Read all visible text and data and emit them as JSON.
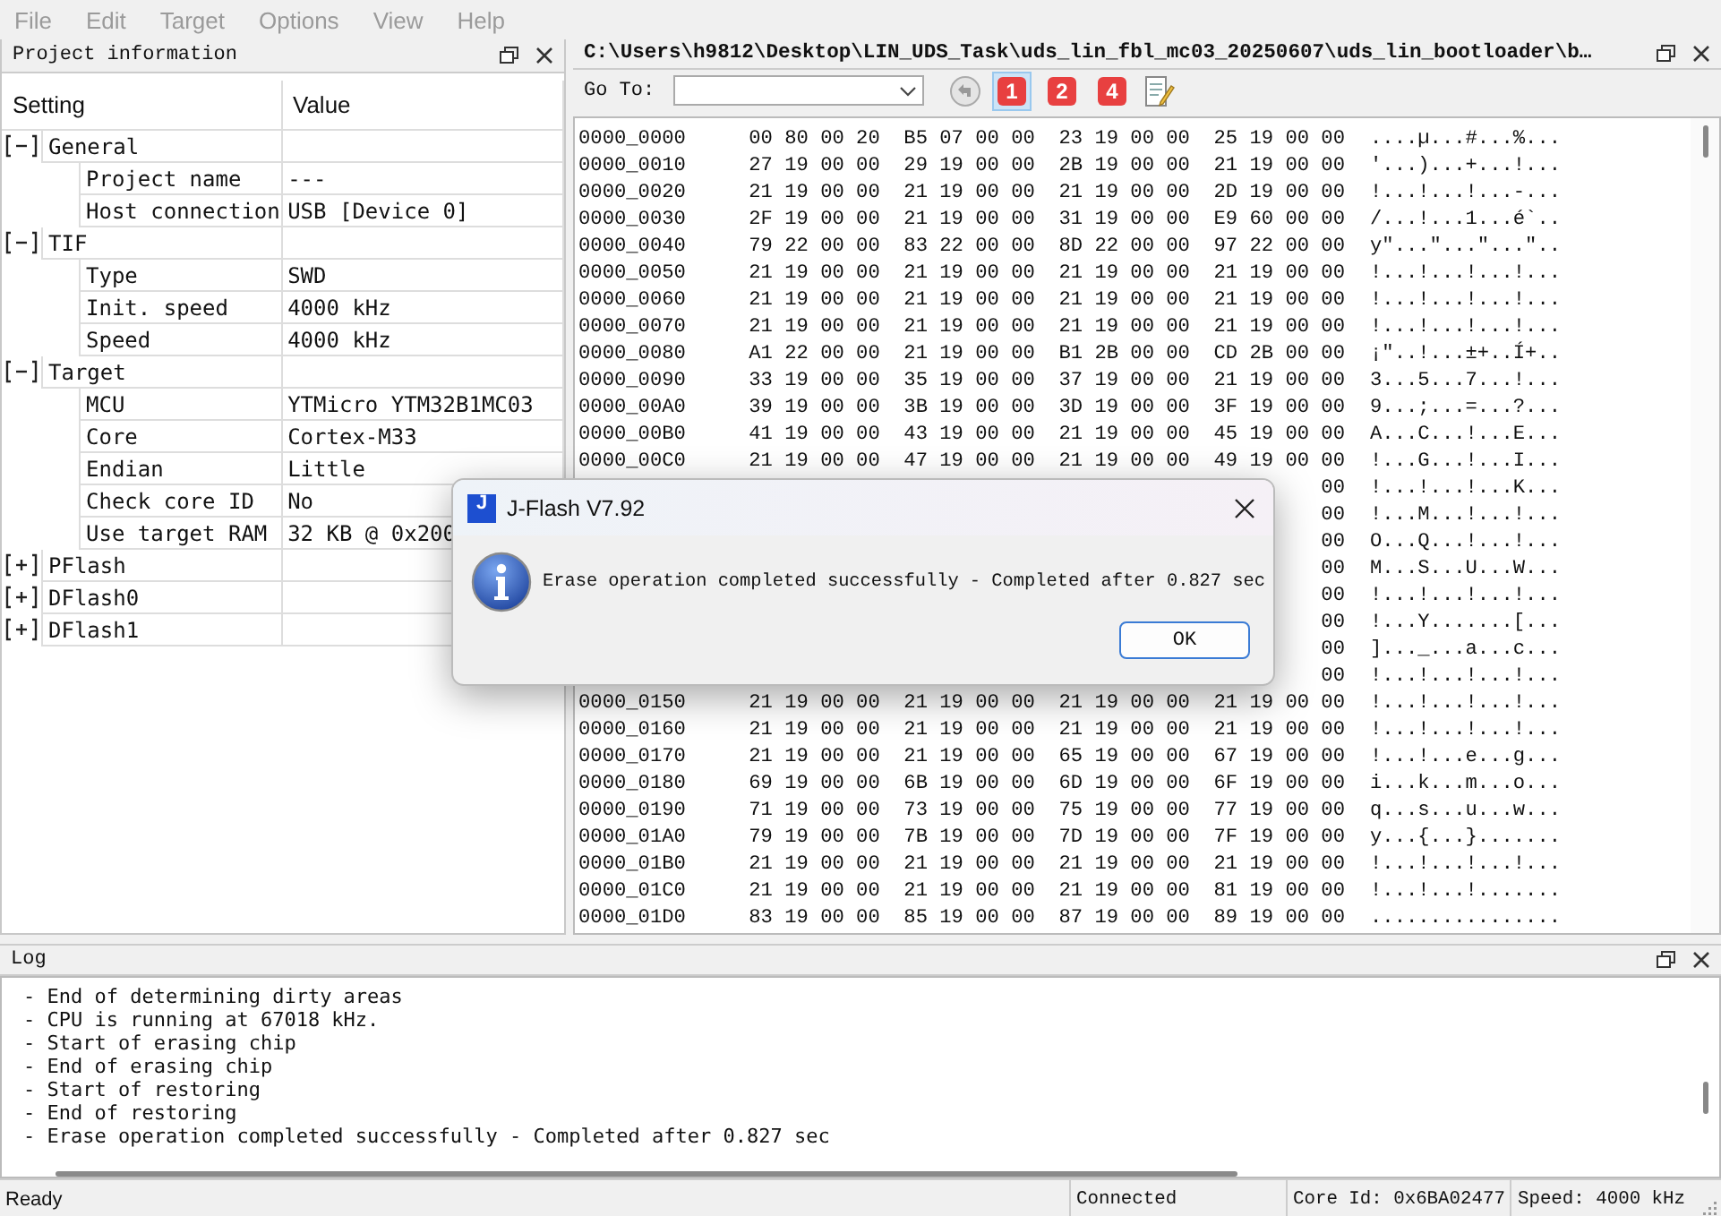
{
  "menu": [
    {
      "label": "File",
      "disabled": true
    },
    {
      "label": "Edit",
      "disabled": true
    },
    {
      "label": "Target",
      "disabled": true
    },
    {
      "label": "Options",
      "disabled": true
    },
    {
      "label": "View",
      "disabled": true
    },
    {
      "label": "Help",
      "disabled": true
    }
  ],
  "project_panel": {
    "title": "Project information",
    "columns": [
      "Setting",
      "Value"
    ],
    "groups": [
      {
        "label": "General",
        "expanded": true,
        "children": [
          {
            "setting": "Project name",
            "value": "---"
          },
          {
            "setting": "Host connection",
            "value": "USB [Device 0]"
          }
        ]
      },
      {
        "label": "TIF",
        "expanded": true,
        "children": [
          {
            "setting": "Type",
            "value": "SWD"
          },
          {
            "setting": "Init. speed",
            "value": "4000 kHz"
          },
          {
            "setting": "Speed",
            "value": "4000 kHz"
          }
        ]
      },
      {
        "label": "Target",
        "expanded": true,
        "children": [
          {
            "setting": "MCU",
            "value": "YTMicro YTM32B1MC03"
          },
          {
            "setting": "Core",
            "value": "Cortex-M33"
          },
          {
            "setting": "Endian",
            "value": "Little"
          },
          {
            "setting": "Check core ID",
            "value": "No"
          },
          {
            "setting": "Use target RAM",
            "value": "32 KB @ 0x200"
          }
        ]
      },
      {
        "label": "PFlash",
        "expanded": false
      },
      {
        "label": "DFlash0",
        "expanded": false
      },
      {
        "label": "DFlash1",
        "expanded": false
      }
    ]
  },
  "data_panel": {
    "title": "C:\\Users\\h9812\\Desktop\\LIN_UDS_Task\\uds_lin_fbl_mc03_20250607\\uds_lin_bootloader\\b…",
    "goto_label": "Go To:",
    "toolbar": [
      {
        "kind": "back"
      },
      {
        "kind": "number",
        "label": "1",
        "selected": true
      },
      {
        "kind": "number",
        "label": "2",
        "selected": false
      },
      {
        "kind": "number",
        "label": "4",
        "selected": false
      },
      {
        "kind": "notes"
      }
    ],
    "rows": [
      {
        "address": "0000_0000",
        "hex": "00 80 00 20  B5 07 00 00  23 19 00 00  25 19 00 00",
        "ascii": "....µ...#...%..."
      },
      {
        "address": "0000_0010",
        "hex": "27 19 00 00  29 19 00 00  2B 19 00 00  21 19 00 00",
        "ascii": "'...)...+...!..."
      },
      {
        "address": "0000_0020",
        "hex": "21 19 00 00  21 19 00 00  21 19 00 00  2D 19 00 00",
        "ascii": "!...!...!...-..."
      },
      {
        "address": "0000_0030",
        "hex": "2F 19 00 00  21 19 00 00  31 19 00 00  E9 60 00 00",
        "ascii": "/...!...1...é`.."
      },
      {
        "address": "0000_0040",
        "hex": "79 22 00 00  83 22 00 00  8D 22 00 00  97 22 00 00",
        "ascii": "y\"...\"...\"...\".."
      },
      {
        "address": "0000_0050",
        "hex": "21 19 00 00  21 19 00 00  21 19 00 00  21 19 00 00",
        "ascii": "!...!...!...!..."
      },
      {
        "address": "0000_0060",
        "hex": "21 19 00 00  21 19 00 00  21 19 00 00  21 19 00 00",
        "ascii": "!...!...!...!..."
      },
      {
        "address": "0000_0070",
        "hex": "21 19 00 00  21 19 00 00  21 19 00 00  21 19 00 00",
        "ascii": "!...!...!...!..."
      },
      {
        "address": "0000_0080",
        "hex": "A1 22 00 00  21 19 00 00  B1 2B 00 00  CD 2B 00 00",
        "ascii": "¡\"..!...±+..Í+.."
      },
      {
        "address": "0000_0090",
        "hex": "33 19 00 00  35 19 00 00  37 19 00 00  21 19 00 00",
        "ascii": "3...5...7...!..."
      },
      {
        "address": "0000_00A0",
        "hex": "39 19 00 00  3B 19 00 00  3D 19 00 00  3F 19 00 00",
        "ascii": "9...;...=...?..."
      },
      {
        "address": "0000_00B0",
        "hex": "41 19 00 00  43 19 00 00  21 19 00 00  45 19 00 00",
        "ascii": "A...C...!...E..."
      },
      {
        "address": "0000_00C0",
        "hex": "21 19 00 00  47 19 00 00  21 19 00 00  49 19 00 00",
        "ascii": "!...G...!...I..."
      },
      {
        "hex": "00",
        "ascii": "!...!...!...K..."
      },
      {
        "hex": "00",
        "ascii": "!...M...!...!..."
      },
      {
        "hex": "00",
        "ascii": "O...Q...!...!..."
      },
      {
        "hex": "00",
        "ascii": "M...S...U...W..."
      },
      {
        "hex": "00",
        "ascii": "!...!...!...!..."
      },
      {
        "hex": "00",
        "ascii": "!...Y.......[..."
      },
      {
        "hex": "00",
        "ascii": "]..._...a...c..."
      },
      {
        "hex": "00",
        "ascii": "!...!...!...!..."
      },
      {
        "address": "0000_0150",
        "hex": "21 19 00 00  21 19 00 00  21 19 00 00  21 19 00 00",
        "ascii": "!...!...!...!..."
      },
      {
        "address": "0000_0160",
        "hex": "21 19 00 00  21 19 00 00  21 19 00 00  21 19 00 00",
        "ascii": "!...!...!...!..."
      },
      {
        "address": "0000_0170",
        "hex": "21 19 00 00  21 19 00 00  65 19 00 00  67 19 00 00",
        "ascii": "!...!...e...g..."
      },
      {
        "address": "0000_0180",
        "hex": "69 19 00 00  6B 19 00 00  6D 19 00 00  6F 19 00 00",
        "ascii": "i...k...m...o..."
      },
      {
        "address": "0000_0190",
        "hex": "71 19 00 00  73 19 00 00  75 19 00 00  77 19 00 00",
        "ascii": "q...s...u...w..."
      },
      {
        "address": "0000_01A0",
        "hex": "79 19 00 00  7B 19 00 00  7D 19 00 00  7F 19 00 00",
        "ascii": "y...{...}......."
      },
      {
        "address": "0000_01B0",
        "hex": "21 19 00 00  21 19 00 00  21 19 00 00  21 19 00 00",
        "ascii": "!...!...!...!..."
      },
      {
        "address": "0000_01C0",
        "hex": "21 19 00 00  21 19 00 00  21 19 00 00  81 19 00 00",
        "ascii": "!...!...!......."
      },
      {
        "address": "0000_01D0",
        "hex": "83 19 00 00  85 19 00 00  87 19 00 00  89 19 00 00",
        "ascii": "................"
      }
    ]
  },
  "log_panel": {
    "title": "Log",
    "lines": [
      "- End of determining dirty areas",
      "- CPU is running at 67018 kHz.",
      "- Start of erasing chip",
      "- End of erasing chip",
      "- Start of restoring",
      "- End of restoring",
      "- Erase operation completed successfully - Completed after 0.827 sec"
    ]
  },
  "status_bar": [
    "Ready",
    "Connected",
    "Core Id: 0x6BA02477",
    "Speed: 4000 kHz"
  ],
  "dialog": {
    "logo": "J",
    "title": "J-Flash V7.92",
    "message": "Erase operation completed successfully - Completed after 0.827 sec",
    "button": "OK"
  }
}
